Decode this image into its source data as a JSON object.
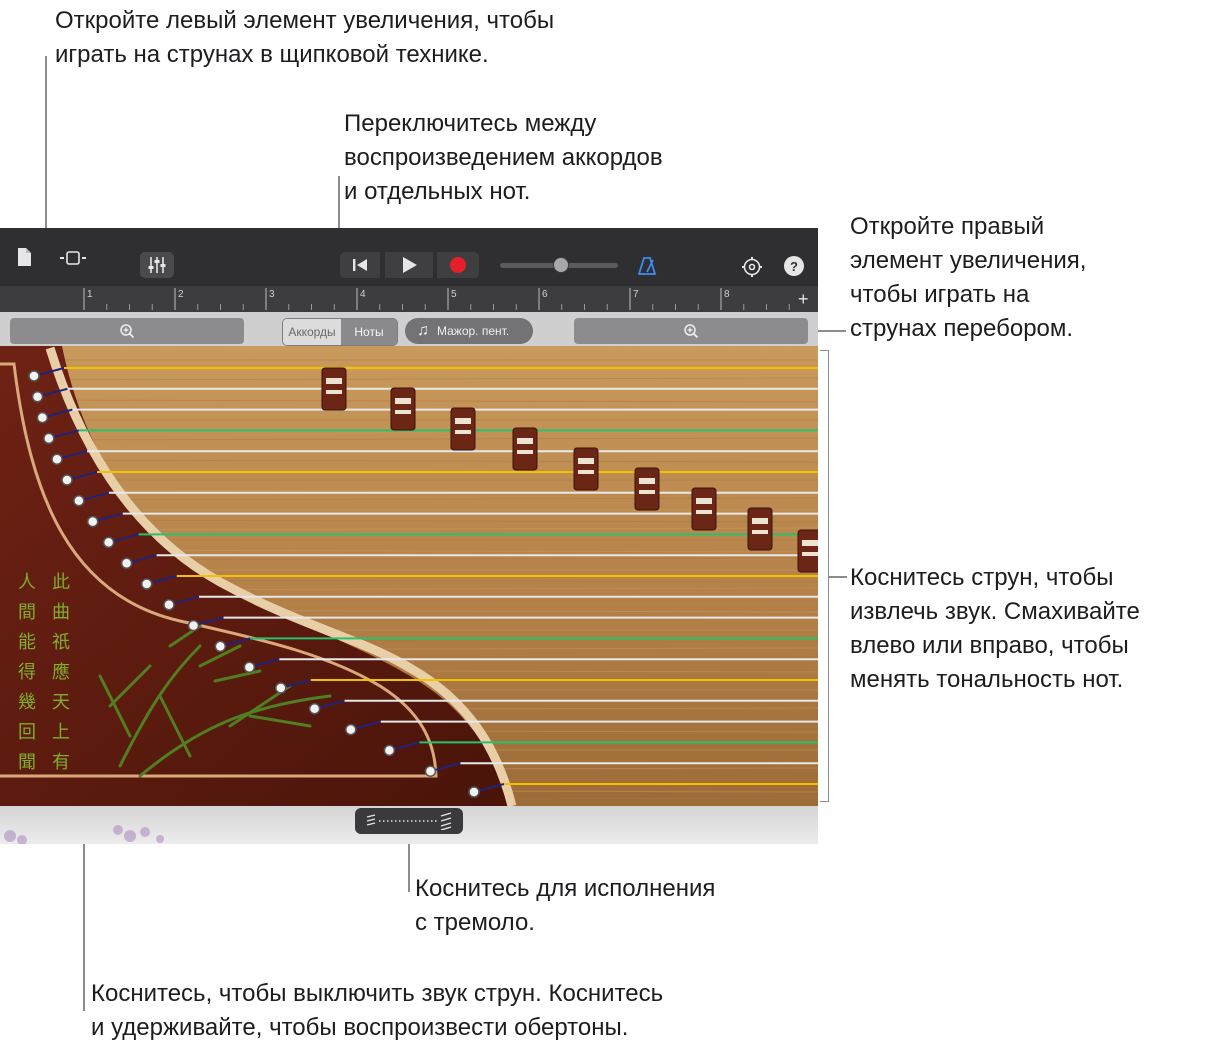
{
  "callouts": {
    "left_zoom": [
      "Откройте левый элемент увеличения, чтобы",
      "играть на струнах в щипковой технике."
    ],
    "chords_notes": [
      "Переключитесь между",
      "воспроизведением аккордов",
      "и отдельных нот."
    ],
    "right_zoom": [
      "Откройте правый",
      "элемент увеличения,",
      "чтобы играть на",
      "струнах перебором."
    ],
    "strings": [
      "Коснитесь струн, чтобы",
      "извлечь звук. Смахивайте",
      "влево или вправо, чтобы",
      "менять тональность нот."
    ],
    "tremolo": [
      "Коснитесь для исполнения",
      "с тремоло."
    ],
    "mute": [
      "Коснитесь, чтобы выключить звук струн. Коснитесь",
      "и удерживайте, чтобы воспроизвести обертоны."
    ]
  },
  "toolbar": {
    "icons": [
      "document-icon",
      "view-toggle-icon",
      "mixer-icon",
      "go-to-start-icon",
      "play-icon",
      "record-icon",
      "metronome-icon",
      "settings-icon",
      "help-icon"
    ],
    "help_label": "?",
    "record_color": "#e5202a",
    "metronome_color": "#3d8cf5",
    "volume_level": 0.51
  },
  "ruler": {
    "bars": [
      "1",
      "2",
      "3",
      "4",
      "5",
      "6",
      "7",
      "8"
    ],
    "add_label": "+"
  },
  "controls": {
    "segment_chords": "Аккорды",
    "segment_notes": "Ноты",
    "selected_segment": "Ноты",
    "scale_label": "Мажор. пент."
  },
  "instrument": {
    "string_colors": {
      "normal": "#e8e8e8",
      "gold": "#f2c200",
      "green": "#27c26b"
    },
    "calligraphy_left": "人間能得幾回聞",
    "calligraphy_right": "此曲祇應天上有"
  }
}
